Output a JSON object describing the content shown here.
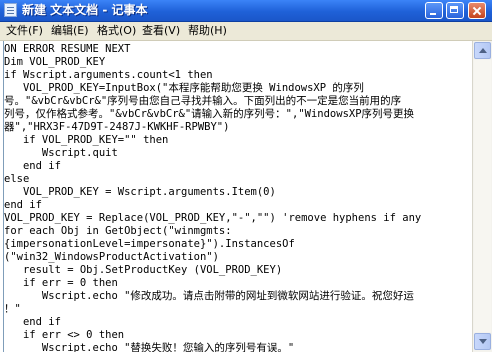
{
  "window": {
    "title": "新建 文本文档 - 记事本"
  },
  "menu": [
    {
      "label": "文件(F)"
    },
    {
      "label": "编辑(E)"
    },
    {
      "label": "格式(O)"
    },
    {
      "label": "查看(V)"
    },
    {
      "label": "帮助(H)"
    }
  ],
  "editor": {
    "lines": [
      "ON ERROR RESUME NEXT",
      "Dim VOL_PROD_KEY",
      "if Wscript.arguments.count<1 then",
      "   VOL_PROD_KEY=InputBox(\"本程序能帮助您更换 WindowsXP 的序列",
      "号。\"&vbCr&vbCr&\"序列号由您自己寻找并输入。下面列出的不一定是您当前用的序",
      "列号，仅作格式参考。\"&vbCr&vbCr&\"请输入新的序列号：\",\"WindowsXP序列号更换",
      "器\",\"HRX3F-47D9T-2487J-KWKHF-RPWBY\")",
      "   if VOL_PROD_KEY=\"\" then",
      "      Wscript.quit",
      "   end if",
      "else",
      "   VOL_PROD_KEY = Wscript.arguments.Item(0)",
      "end if",
      "VOL_PROD_KEY = Replace(VOL_PROD_KEY,\"-\",\"\") 'remove hyphens if any",
      "for each Obj in GetObject(\"winmgmts:",
      "{impersonationLevel=impersonate}\").InstancesOf",
      "(\"win32_WindowsProductActivation\")",
      "   result = Obj.SetProductKey (VOL_PROD_KEY)",
      "   if err = 0 then",
      "      Wscript.echo \"修改成功。请点击附带的网址到微软网站进行验证。祝您好运",
      "！\"",
      "   end if",
      "   if err <> 0 then",
      "      Wscript.echo \"替换失败！您输入的序列号有误。\""
    ]
  }
}
